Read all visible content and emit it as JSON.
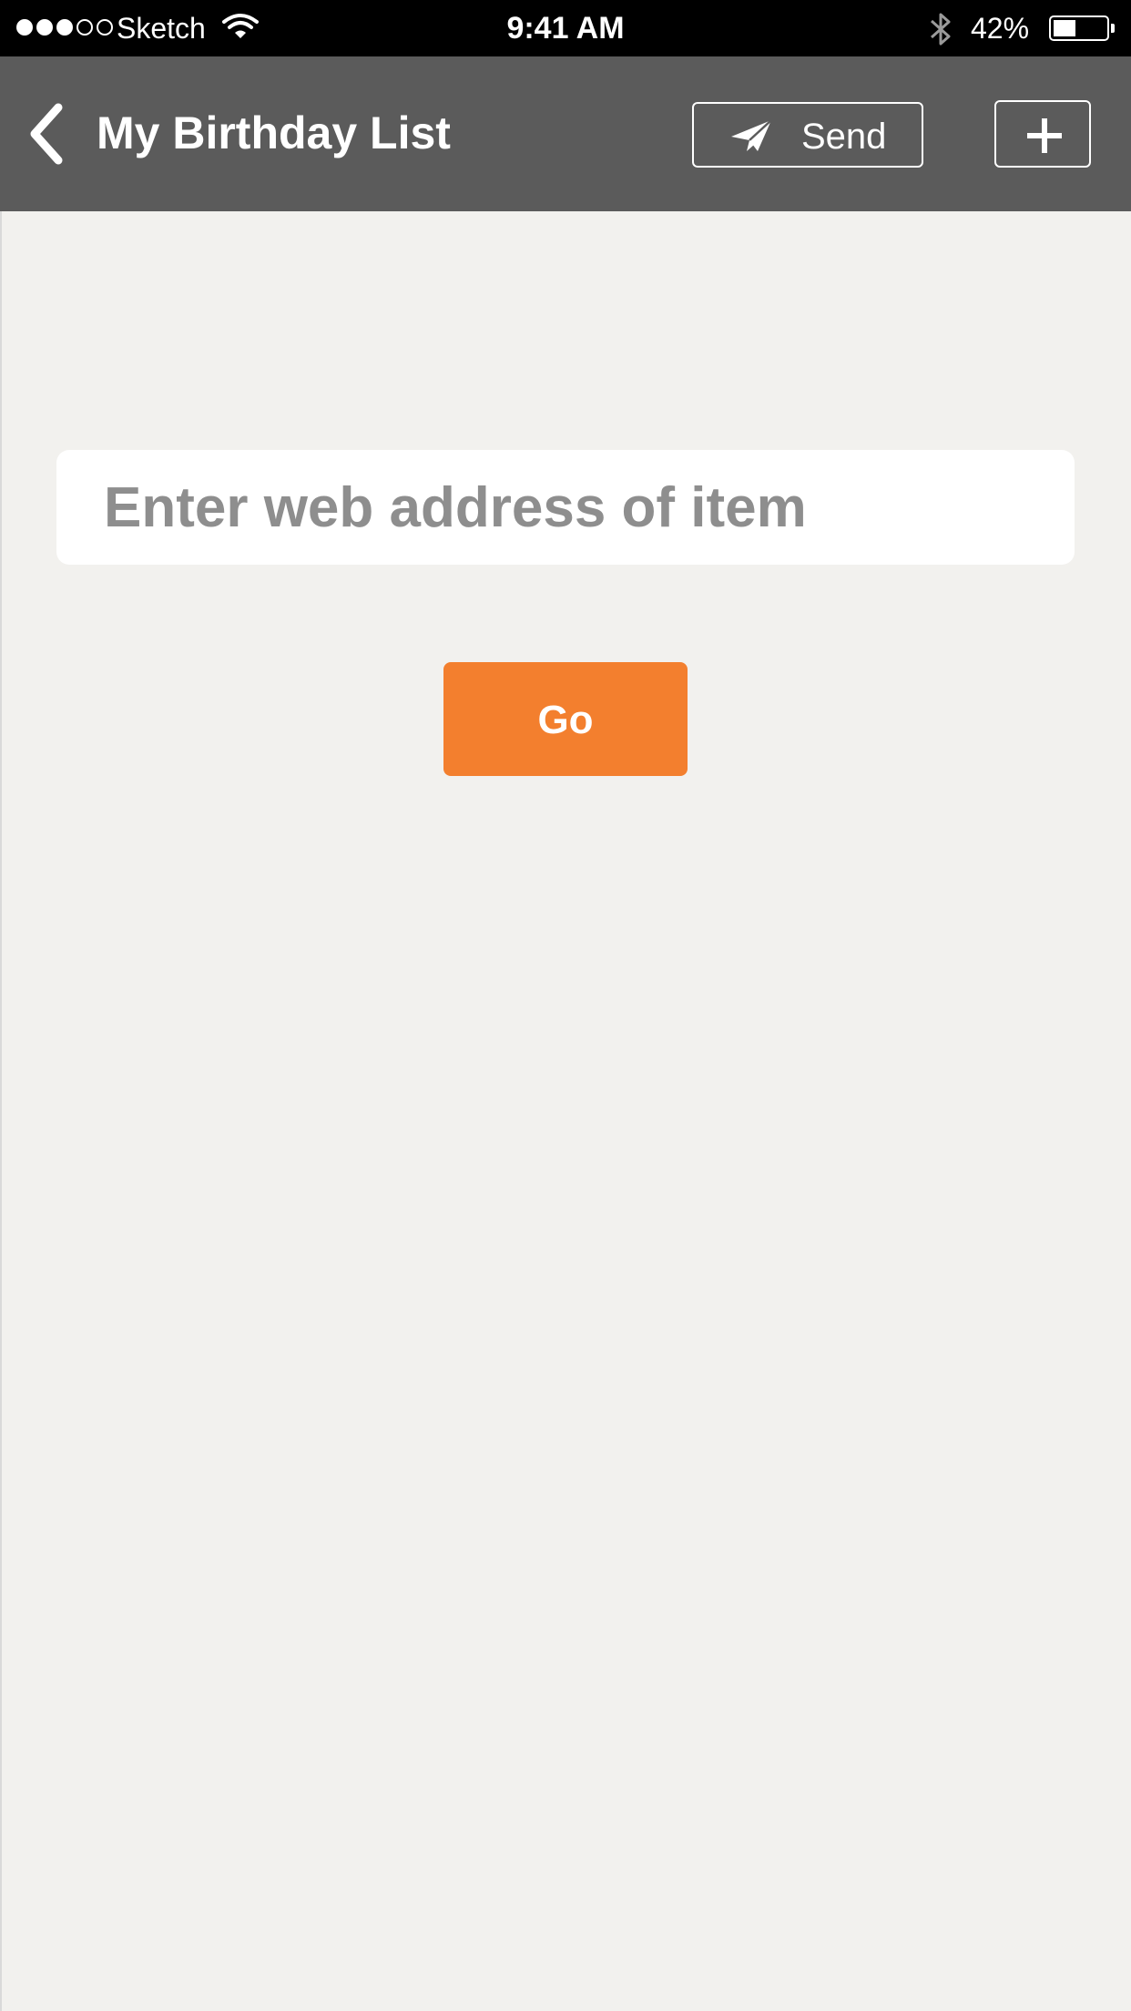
{
  "status_bar": {
    "carrier": "Sketch",
    "time": "9:41 AM",
    "battery_percent": "42%",
    "signal_bars_filled": 3,
    "signal_bars_total": 5,
    "battery_level": 0.42,
    "icons": [
      "wifi-icon",
      "bluetooth-icon",
      "battery-icon"
    ]
  },
  "nav": {
    "title": "My Birthday List",
    "send_label": "Send",
    "back_icon": "chevron-left-icon",
    "send_icon": "paper-plane-icon",
    "add_icon": "plus-icon"
  },
  "form": {
    "url_placeholder": "Enter web address of item",
    "url_value": "",
    "go_label": "Go"
  },
  "colors": {
    "status_bar_bg": "#000000",
    "nav_bg": "#5b5b5b",
    "page_bg": "#f2f1ee",
    "accent": "#f37f2e",
    "placeholder": "#8e8e8e"
  }
}
